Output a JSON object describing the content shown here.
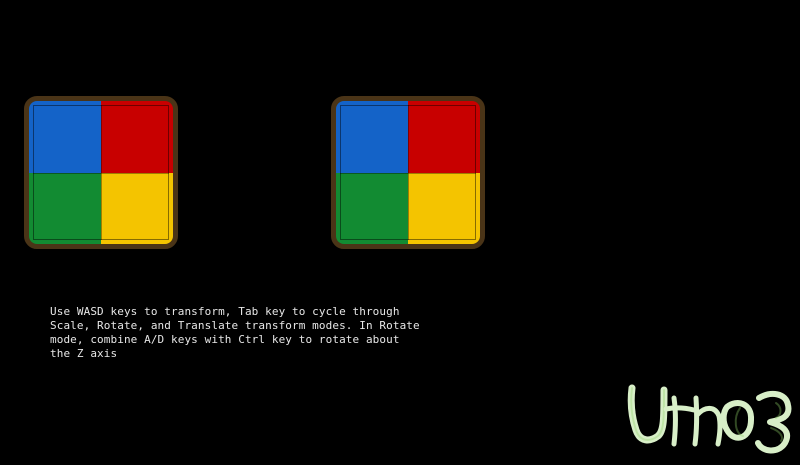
{
  "colors": {
    "background": "#000000",
    "frame": "#4a3417",
    "blue": "#1463c8",
    "red": "#c80000",
    "green": "#128b32",
    "yellow": "#f4c400",
    "text": "#e6e6e6",
    "logo": "#d8efc8"
  },
  "sprites": [
    {
      "name": "left-quad",
      "quadrants": {
        "top_left": "blue",
        "top_right": "red",
        "bottom_left": "green",
        "bottom_right": "yellow"
      }
    },
    {
      "name": "right-quad",
      "quadrants": {
        "top_left": "blue",
        "top_right": "red",
        "bottom_left": "green",
        "bottom_right": "yellow"
      }
    }
  ],
  "instructions": "Use WASD keys to transform, Tab key to cycle through\nScale, Rotate, and Translate transform modes. In Rotate\nmode, combine A/D keys with Ctrl key to rotate about\nthe Z axis",
  "logo": {
    "text": "Urho3D"
  }
}
